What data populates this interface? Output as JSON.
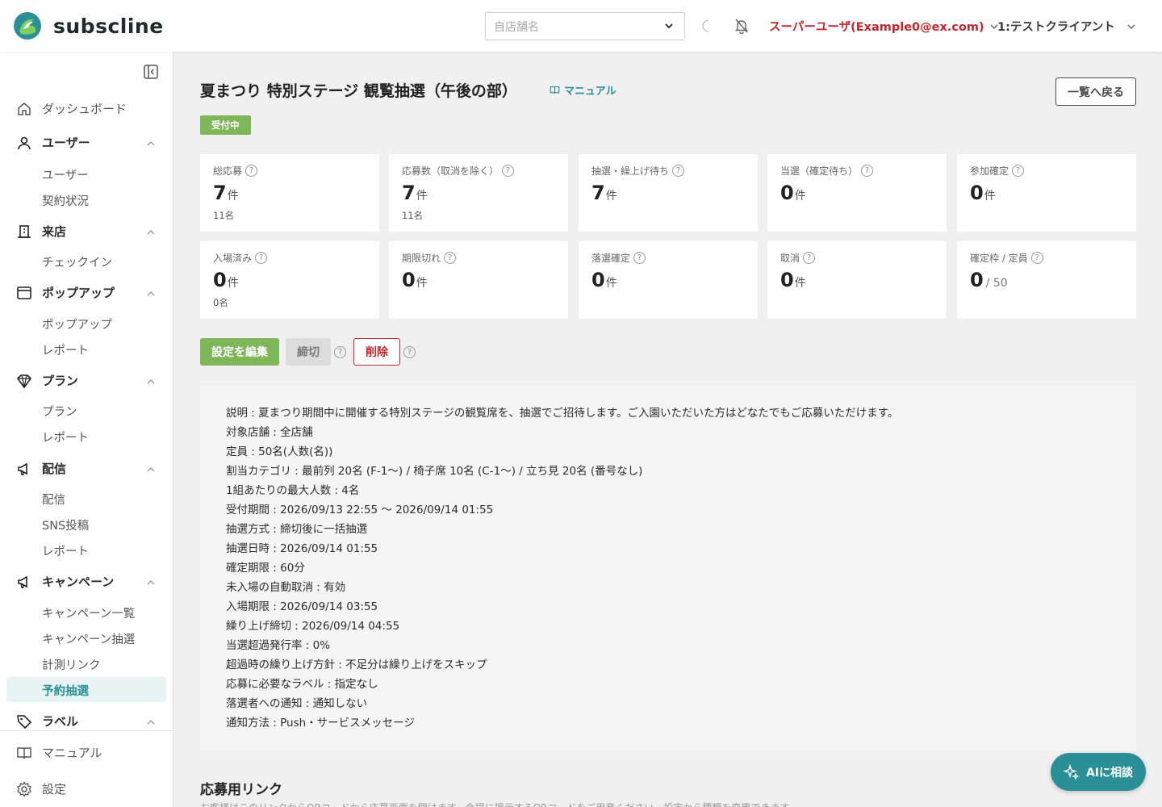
{
  "app": {
    "logo_text": "subscline"
  },
  "header": {
    "store_placeholder": "自店舗名",
    "user_label": "スーパーユーザ(Example0@ex.com)",
    "client_label": "1:テストクライアント"
  },
  "sidebar": {
    "dashboard": "ダッシュボード",
    "groups": [
      {
        "label": "ユーザー",
        "items": [
          "ユーザー",
          "契約状況"
        ]
      },
      {
        "label": "来店",
        "items": [
          "チェックイン"
        ]
      },
      {
        "label": "ポップアップ",
        "items": [
          "ポップアップ",
          "レポート"
        ]
      },
      {
        "label": "プラン",
        "items": [
          "プラン",
          "レポート"
        ]
      },
      {
        "label": "配信",
        "items": [
          "配信",
          "SNS投稿",
          "レポート"
        ]
      },
      {
        "label": "キャンペーン",
        "items": [
          "キャンペーン一覧",
          "キャンペーン抽選",
          "計測リンク",
          "予約抽選"
        ]
      },
      {
        "label": "ラベル",
        "items": []
      }
    ],
    "manual": "マニュアル",
    "settings": "設定"
  },
  "page": {
    "title": "夏まつり 特別ステージ 観覧抽選（午後の部）",
    "manual_link": "マニュアル",
    "back_button": "一覧へ戻る",
    "status_badge": "受付中"
  },
  "stats": [
    {
      "label": "総応募",
      "num": "7",
      "unit": "件",
      "sub": "11名"
    },
    {
      "label": "応募数（取消を除く）",
      "num": "7",
      "unit": "件",
      "sub": "11名"
    },
    {
      "label": "抽選・繰上げ待ち",
      "num": "7",
      "unit": "件",
      "sub": ""
    },
    {
      "label": "当選（確定待ち）",
      "num": "0",
      "unit": "件",
      "sub": ""
    },
    {
      "label": "参加確定",
      "num": "0",
      "unit": "件",
      "sub": ""
    },
    {
      "label": "入場済み",
      "num": "0",
      "unit": "件",
      "sub": "0名"
    },
    {
      "label": "期限切れ",
      "num": "0",
      "unit": "件",
      "sub": ""
    },
    {
      "label": "落選確定",
      "num": "0",
      "unit": "件",
      "sub": ""
    },
    {
      "label": "取消",
      "num": "0",
      "unit": "件",
      "sub": ""
    },
    {
      "label": "確定枠 / 定員",
      "num": "0",
      "unit": "/ 50",
      "sub": ""
    }
  ],
  "actions": {
    "edit": "設定を編集",
    "close": "締切",
    "delete": "削除"
  },
  "description": [
    "説明 : 夏まつり期間中に開催する特別ステージの観覧席を、抽選でご招待します。ご入園いただいた方はどなたでもご応募いただけます。",
    "対象店舗 : 全店舗",
    "定員 : 50名(人数(名))",
    "割当カテゴリ : 最前列 20名 (F-1〜) / 椅子席 10名 (C-1〜) / 立ち見 20名 (番号なし)",
    "1組あたりの最大人数 : 4名",
    "受付期間 : 2026/09/13 22:55 〜 2026/09/14 01:55",
    "抽選方式 : 締切後に一括抽選",
    "抽選日時 : 2026/09/14 01:55",
    "確定期限 : 60分",
    "未入場の自動取消 : 有効",
    "入場期限 : 2026/09/14 03:55",
    "繰り上げ締切 : 2026/09/14 04:55",
    "当選超過発行率 : 0%",
    "超過時の繰り上げ方針 : 不足分は繰り上げをスキップ",
    "応募に必要なラベル : 指定なし",
    "落選者への通知 : 通知しない",
    "通知方法 : Push・サービスメッセージ"
  ],
  "link_section": {
    "title": "応募用リンク",
    "subtitle": "お客様はこのリンクからQRコードから応募画面を開けます。会場に掲示するQRコードをご用意ください。設定から種類を変更できます。"
  },
  "ai_button": "AIに相談",
  "colors": {
    "accent": "#2a8f96",
    "success": "#7fb65a",
    "danger": "#c4262e"
  }
}
